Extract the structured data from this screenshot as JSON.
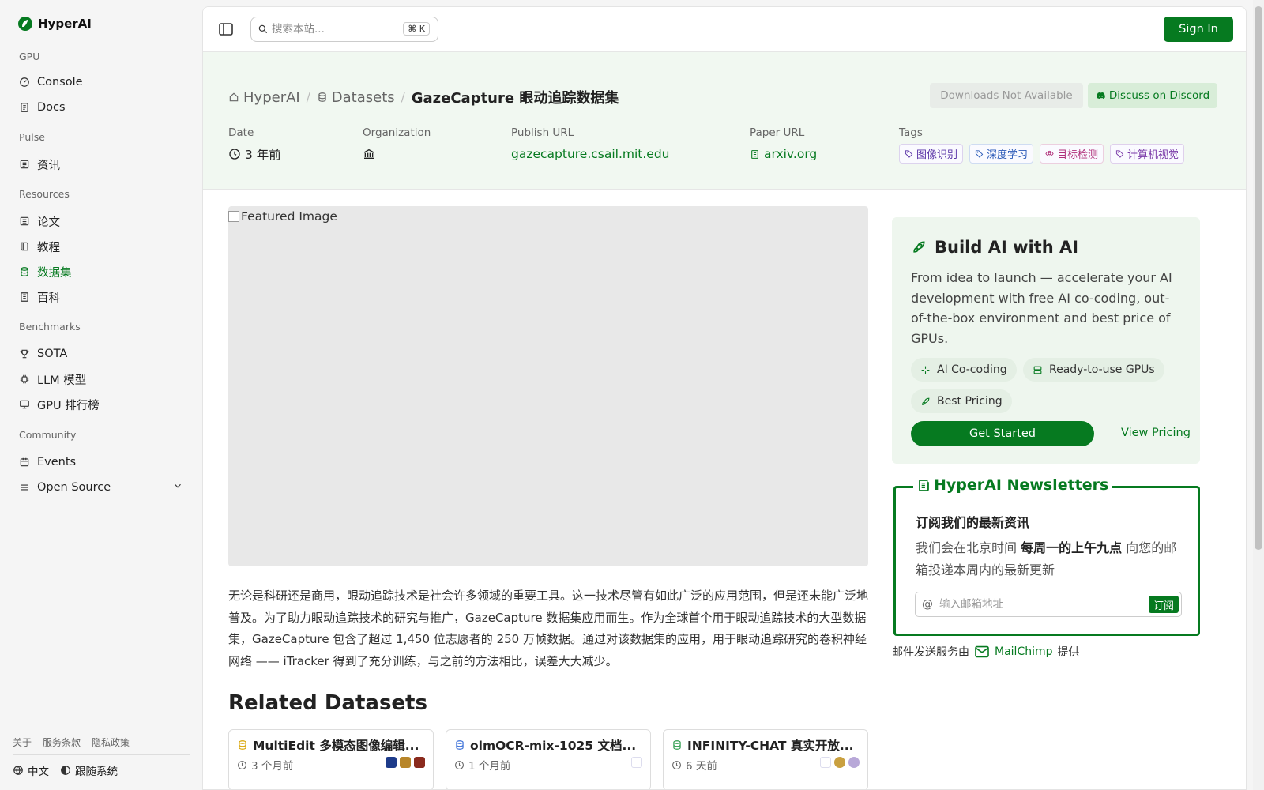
{
  "app": {
    "name": "HyperAI"
  },
  "sidebar": {
    "sections": [
      {
        "label": "GPU",
        "items": [
          {
            "label": "Console",
            "icon": "gauge-icon"
          },
          {
            "label": "Docs",
            "icon": "doc-icon"
          }
        ]
      },
      {
        "label": "Pulse",
        "items": [
          {
            "label": "资讯",
            "icon": "news-icon"
          }
        ]
      },
      {
        "label": "Resources",
        "items": [
          {
            "label": "论文",
            "icon": "paper-icon"
          },
          {
            "label": "教程",
            "icon": "book-icon"
          },
          {
            "label": "数据集",
            "icon": "database-icon",
            "active": true
          },
          {
            "label": "百科",
            "icon": "wiki-icon"
          }
        ]
      },
      {
        "label": "Benchmarks",
        "items": [
          {
            "label": "SOTA",
            "icon": "trophy-icon"
          },
          {
            "label": "LLM 模型",
            "icon": "chip-icon"
          },
          {
            "label": "GPU 排行榜",
            "icon": "monitor-icon"
          }
        ]
      },
      {
        "label": "Community",
        "items": [
          {
            "label": "Events",
            "icon": "calendar-icon"
          },
          {
            "label": "Open Source",
            "icon": "list-icon"
          }
        ]
      }
    ],
    "footer_links": [
      "关于",
      "服务条款",
      "隐私政策"
    ],
    "language": "中文",
    "tracking": "跟随系统"
  },
  "topbar": {
    "search_placeholder": "搜索本站...",
    "search_shortcut": "⌘ K",
    "sign_in": "Sign In"
  },
  "header": {
    "breadcrumb": [
      "HyperAI",
      "Datasets",
      "GazeCapture 眼动追踪数据集"
    ],
    "downloads": "Downloads Not Available",
    "discord": "Discuss on Discord",
    "meta": {
      "date_label": "Date",
      "date_value": "3 年前",
      "org_label": "Organization",
      "publish_label": "Publish URL",
      "publish_value": "gazecapture.csail.mit.edu",
      "paper_label": "Paper URL",
      "paper_value": "arxiv.org",
      "tags_label": "Tags",
      "tags": [
        "图像识别",
        "深度学习",
        "目标检测",
        "计算机视觉"
      ]
    }
  },
  "main": {
    "featured_alt": "Featured Image",
    "description": "无论是科研还是商用，眼动追踪技术是社会许多领域的重要工具。这一技术尽管有如此广泛的应用范围，但是还未能广泛地普及。为了助力眼动追踪技术的研究与推广，GazeCapture 数据集应用而生。作为全球首个用于眼动追踪技术的大型数据集，GazeCapture 包含了超过 1,450 位志愿者的 250 万帧数据。通过对该数据集的应用，用于眼动追踪研究的卷积神经网络 —— iTracker 得到了充分训练，与之前的方法相比，误差大大减少。",
    "related_title": "Related Datasets",
    "related": [
      {
        "title": "MultiEdit 多模态图像编辑...",
        "time": "3 个月前",
        "icon_color": "#d9a300"
      },
      {
        "title": "olmOCR-mix-1025 文档...",
        "time": "1 个月前",
        "icon_color": "#3a6fd8"
      },
      {
        "title": "INFINITY-CHAT 真实开放...",
        "time": "6 天前",
        "icon_color": "#2a9a4a"
      }
    ]
  },
  "promo": {
    "title": "Build AI with AI",
    "text": "From idea to launch — accelerate your AI development with free AI co-coding, out-of-the-box environment and best price of GPUs.",
    "pills": [
      "AI Co-coding",
      "Ready-to-use GPUs",
      "Best Pricing"
    ],
    "get_started": "Get Started",
    "view_pricing": "View Pricing"
  },
  "newsletter": {
    "title": "HyperAI Newsletters",
    "subtitle": "订阅我们的最新资讯",
    "text_pre": "我们会在北京时间",
    "text_bold": "每周一的上午九点",
    "text_post": "向您的邮箱投递本周内的最新更新",
    "email_placeholder": "输入邮箱地址",
    "subscribe": "订阅",
    "provider_pre": "邮件发送服务由",
    "provider": "MailChimp",
    "provider_post": "提供"
  },
  "colors": {
    "accent": "#067a20",
    "header_bg": "#f1f8f1",
    "promo_bg": "#eef6ee"
  }
}
